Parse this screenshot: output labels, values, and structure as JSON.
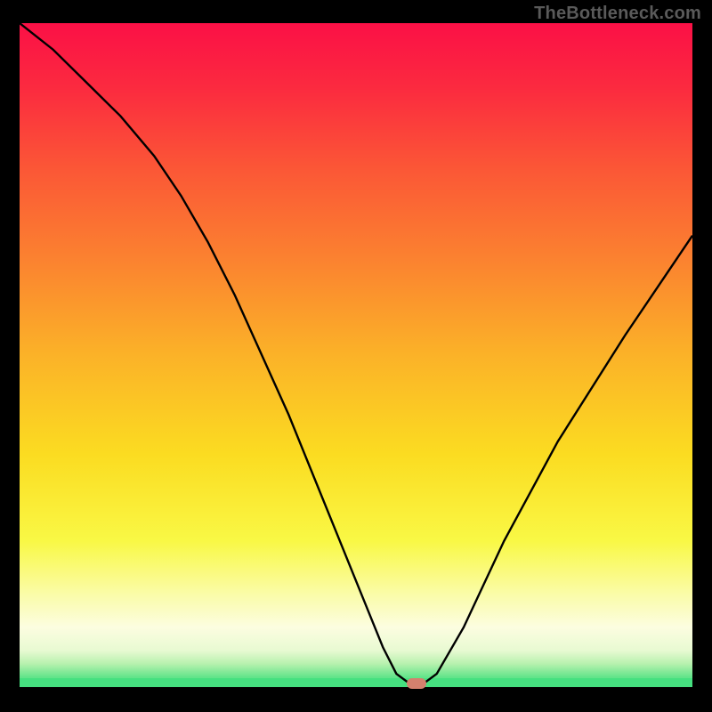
{
  "watermark": "TheBottleneck.com",
  "colors": {
    "gradient_stops": [
      {
        "offset": 0.0,
        "color": "#fb1046"
      },
      {
        "offset": 0.1,
        "color": "#fb2b3f"
      },
      {
        "offset": 0.22,
        "color": "#fb5736"
      },
      {
        "offset": 0.35,
        "color": "#fb8030"
      },
      {
        "offset": 0.5,
        "color": "#fbb228"
      },
      {
        "offset": 0.65,
        "color": "#fbdc21"
      },
      {
        "offset": 0.78,
        "color": "#f9f845"
      },
      {
        "offset": 0.86,
        "color": "#fafca8"
      },
      {
        "offset": 0.91,
        "color": "#fcfde0"
      },
      {
        "offset": 0.945,
        "color": "#e8fad2"
      },
      {
        "offset": 0.965,
        "color": "#b7f1ae"
      },
      {
        "offset": 0.985,
        "color": "#63e48a"
      },
      {
        "offset": 1.0,
        "color": "#46e080"
      }
    ],
    "curve": "#000000",
    "marker": "#d4806e",
    "bottom_line": "#46e080",
    "background": "#000000",
    "watermark": "#5a5a5a"
  },
  "chart_data": {
    "type": "line",
    "title": "",
    "xlabel": "",
    "ylabel": "",
    "xlim": [
      0,
      100
    ],
    "ylim": [
      0,
      100
    ],
    "grid": false,
    "legend": false,
    "comment": "Single V-shaped bottleneck curve. Minimum (optimal point) near x≈59 where y≈0.",
    "series": [
      {
        "name": "bottleneck_curve",
        "x": [
          0,
          5,
          10,
          15,
          20,
          24,
          28,
          32,
          36,
          40,
          44,
          48,
          52,
          54,
          56,
          58,
          59,
          60,
          62,
          66,
          72,
          80,
          90,
          100
        ],
        "y": [
          100,
          96,
          91,
          86,
          80,
          74,
          67,
          59,
          50,
          41,
          31,
          21,
          11,
          6,
          2,
          0.5,
          0,
          0.5,
          2,
          9,
          22,
          37,
          53,
          68
        ]
      }
    ],
    "marker": {
      "x": 59,
      "y": 0
    }
  }
}
